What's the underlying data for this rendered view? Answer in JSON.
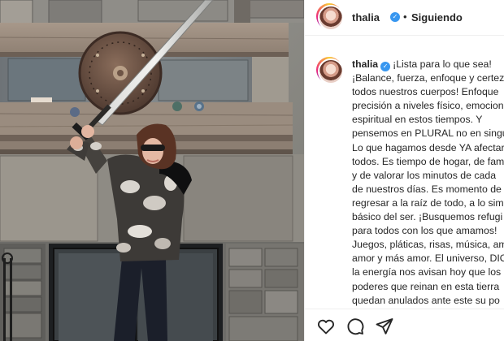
{
  "post": {
    "username": "thalia",
    "follow_status": "Siguiendo",
    "caption_user": "thalia",
    "caption_text": "¡Lista para lo que sea!\n¡Balance, fuerza, enfoque y certeza\ntodos nuestros cuerpos! Enfoque\nprecisión a niveles físico, emocion\nespiritual en estos tiempos. Y\npensemos en PLURAL no en singu\nLo que hagamos desde YA afectar\ntodos. Es tiempo de hogar, de fam\ny de valorar los minutos de cada\nde nuestros días. Es momento de\nregresar a la raíz de todo, a lo sim\nbásico del ser. ¡Busquemos refugi\npara todos con los que amamos!\nJuegos, pláticas, risas, música, am\namor y más amor. El universo, DIO\nla energía nos avisan hoy que los\npoderes que reinan en esta tierra\nquedan anulados ante este su po\nNi el gobierno, ni la ciencia, ni la"
  },
  "icons": {
    "verified": "verified-badge-icon",
    "like": "heart-icon",
    "comment": "comment-bubble-icon",
    "share": "paper-plane-icon"
  },
  "colors": {
    "verified_blue": "#3897f0",
    "text": "#262626",
    "divider": "#efefef"
  }
}
